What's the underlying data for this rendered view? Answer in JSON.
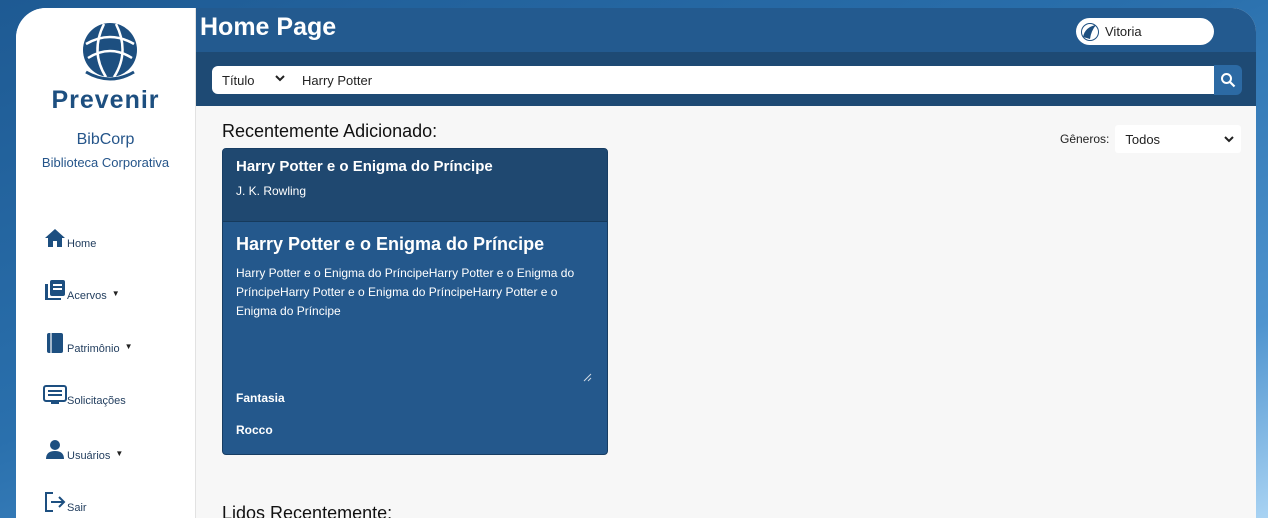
{
  "sidebar": {
    "logo_text": "Prevenir",
    "app_name": "BibCorp",
    "app_subtitle": "Biblioteca Corporativa",
    "items": [
      {
        "label": "Home",
        "icon": "home-icon"
      },
      {
        "label": "Acervos",
        "icon": "books-icon",
        "has_caret": true
      },
      {
        "label": "Patrimônio",
        "icon": "book-icon",
        "has_caret": true
      },
      {
        "label": "Solicitações",
        "icon": "monitor-list-icon"
      },
      {
        "label": "Usuários",
        "icon": "user-icon",
        "has_caret": true
      },
      {
        "label": "Sair",
        "icon": "logout-icon"
      }
    ]
  },
  "header": {
    "title": "Home Page",
    "user_name": "Vitoria"
  },
  "search": {
    "field_selected": "Título",
    "query": "Harry Potter"
  },
  "main": {
    "recent_added_title": "Recentemente Adicionado:",
    "genres_label": "Gêneros:",
    "genres_selected": "Todos",
    "recent_read_title": "Lidos Recentemente:"
  },
  "book_card": {
    "header_title": "Harry Potter e o Enigma do Príncipe",
    "author": "J. K. Rowling",
    "body_title": "Harry Potter e o Enigma do Príncipe",
    "description": "Harry Potter e o Enigma do PríncipeHarry Potter e o Enigma do PríncipeHarry Potter e o Enigma do PríncipeHarry Potter e o Enigma do Príncipe",
    "genre": "Fantasia",
    "publisher": "Rocco"
  },
  "colors": {
    "primary": "#235a8f",
    "dark": "#1e4a74",
    "card": "#24588c",
    "logo": "#1d4f80"
  }
}
